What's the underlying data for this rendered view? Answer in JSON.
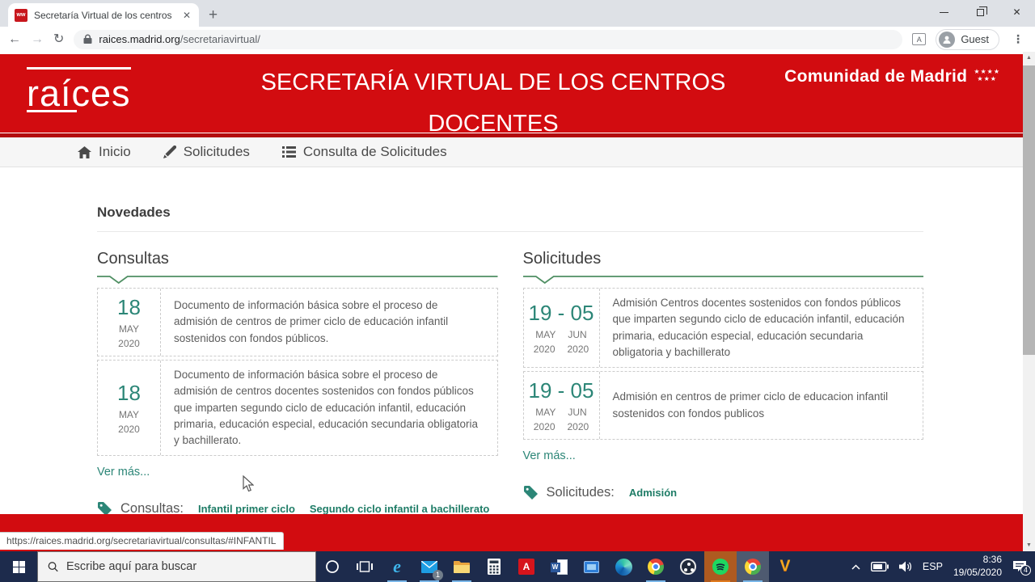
{
  "browser": {
    "tab_title": "Secretaría Virtual de los centros",
    "url_host": "raices.madrid.org",
    "url_path": "/secretariavirtual/",
    "profile_label": "Guest"
  },
  "icons": {
    "favicon_glyph": "ww",
    "back": "←",
    "forward": "→",
    "reload": "↻",
    "translate": "A",
    "menu": "⋮",
    "tab_close": "✕",
    "new_tab": "+",
    "window_close": "✕",
    "scroll_up": "▲",
    "scroll_down": "▼",
    "stars_top": "★★★★",
    "stars_bottom": "★★★",
    "ie_glyph": "e",
    "acrobat_glyph": "A",
    "word_glyph": "W",
    "freemake_glyph": "V"
  },
  "header": {
    "logo_text": "raíces",
    "title": "SECRETARÍA VIRTUAL DE LOS CENTROS DOCENTES",
    "brand_name": "Comunidad de Madrid"
  },
  "nav": {
    "items": [
      {
        "label": "Inicio"
      },
      {
        "label": "Solicitudes"
      },
      {
        "label": "Consulta de Solicitudes"
      }
    ]
  },
  "main": {
    "section_title": "Novedades",
    "consultas": {
      "title": "Consultas",
      "items": [
        {
          "day": "18",
          "month": "MAY",
          "year": "2020",
          "text": "Documento de información básica sobre el proceso de admisión de centros de primer ciclo de educación infantil sostenidos con fondos públicos."
        },
        {
          "day": "18",
          "month": "MAY",
          "year": "2020",
          "text": "Documento de información básica sobre el proceso de admisión de centros docentes sostenidos con fondos públicos que imparten segundo ciclo de educación infantil, educación primaria, educación especial, educación secundaria obligatoria y bachillerato."
        }
      ],
      "more": "Ver más...",
      "tags_label": "Consultas:",
      "tags": [
        "Infantil primer ciclo",
        "Segundo ciclo infantil a bachillerato"
      ]
    },
    "solicitudes": {
      "title": "Solicitudes",
      "items": [
        {
          "days": "19 - 05",
          "month_start": "MAY",
          "month_end": "JUN",
          "year_start": "2020",
          "year_end": "2020",
          "text": "Admisión Centros docentes sostenidos con fondos públicos que imparten segundo ciclo de educación infantil, educación primaria, educación especial, educación secundaria obligatoria y bachillerato"
        },
        {
          "days": "19 - 05",
          "month_start": "MAY",
          "month_end": "JUN",
          "year_start": "2020",
          "year_end": "2020",
          "text": "Admisión en centros de primer ciclo de educacion infantil sostenidos con fondos publicos"
        }
      ],
      "more": "Ver más...",
      "tags_label": "Solicitudes:",
      "tags": [
        "Admisión"
      ]
    }
  },
  "statusbar": {
    "link": "https://raices.madrid.org/secretariavirtual/consultas/#INFANTIL"
  },
  "taskbar": {
    "search_placeholder": "Escribe aquí para buscar",
    "language": "ESP",
    "time": "8:36",
    "date": "19/05/2020",
    "mail_badge": "1",
    "notification_count": "4"
  },
  "colors": {
    "header_red": "#d20c10",
    "header_red_dark": "#b30b0e",
    "accent_teal": "#2c8677",
    "link_green": "#1e7c66",
    "rule_green": "#4f8f63",
    "taskbar_navy": "#1d2b4c"
  }
}
